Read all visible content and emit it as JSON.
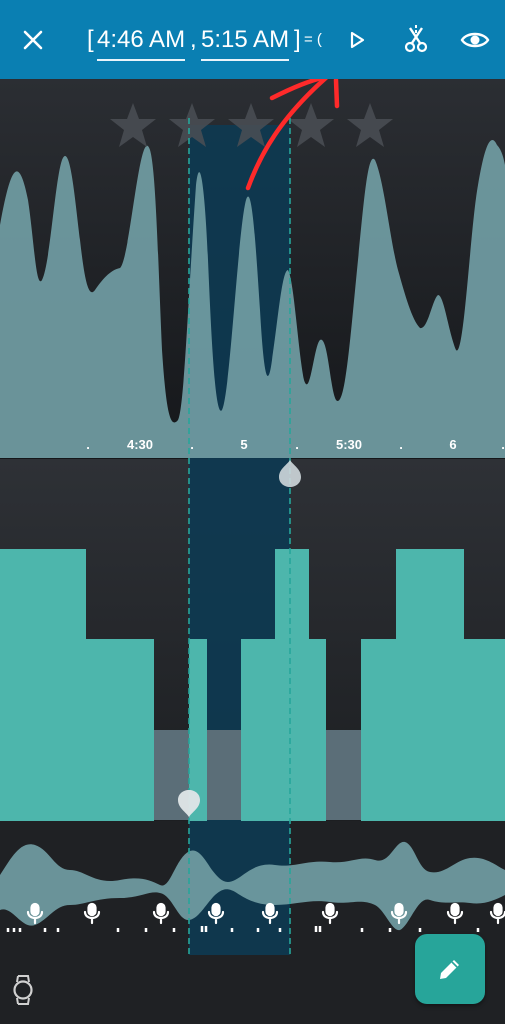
{
  "header": {
    "bracket_open": "[",
    "start_time": "4:46 AM",
    "separator": ",",
    "end_time": "5:15 AM",
    "bracket_close": "]",
    "equals": "= (",
    "icons": {
      "close": "close-icon",
      "play": "play-icon",
      "cut": "scissors-icon",
      "view": "eye-icon"
    }
  },
  "rating": {
    "stars_total": 5,
    "stars_filled": 0
  },
  "timeline": {
    "labels": [
      ".",
      "4:30",
      ".",
      "5",
      ".",
      "5:30",
      ".",
      "6",
      "."
    ]
  },
  "colors": {
    "topbar": "#0a7fb2",
    "background": "#1f2124",
    "wave_fill": "#6f9aa0",
    "bars": "#4db6ac",
    "selection": "#0d3a52",
    "dashed": "#26a69a",
    "annotation": "#ff2a2a"
  },
  "footer": {
    "fab_icon": "pencil-icon",
    "watch_icon": "watch-icon"
  }
}
